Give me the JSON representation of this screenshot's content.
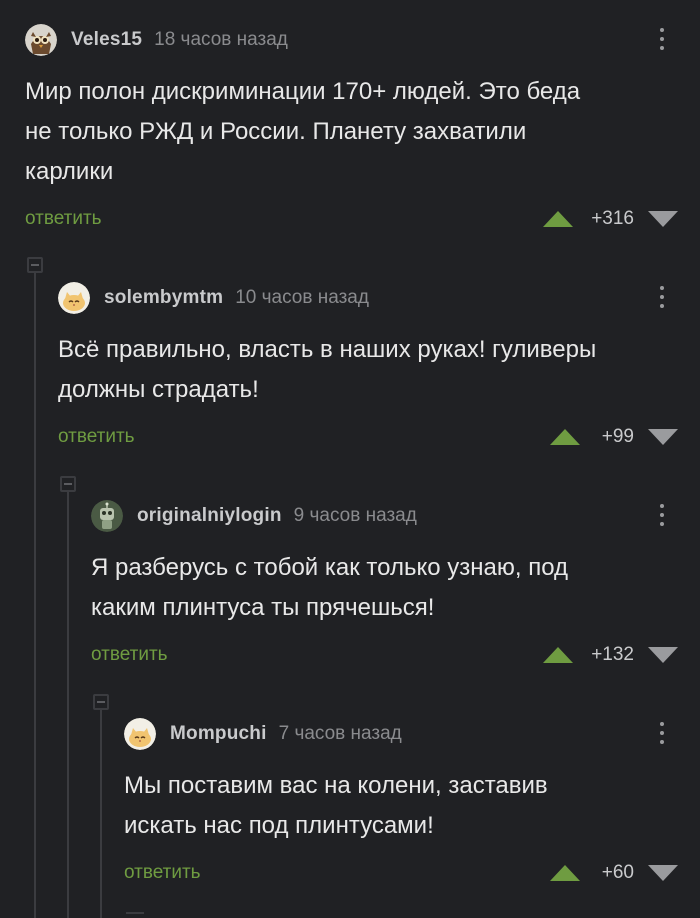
{
  "comments": [
    {
      "nick": "Veles15",
      "time": "18 часов назад",
      "text_lines": [
        "Мир полон дискриминации 170+ людей. Это беда",
        "не только РЖД и России. Планету захватили",
        "карлики"
      ],
      "reply_label": "ответить",
      "score": "+316",
      "avatar_icon": "owl-avatar-icon"
    },
    {
      "nick": "solembymtm",
      "time": "10 часов назад",
      "text_lines": [
        "Всё правильно, власть в наших руках! гуливеры",
        "должны страдать!"
      ],
      "reply_label": "ответить",
      "score": "+99",
      "avatar_icon": "cat-avatar-icon"
    },
    {
      "nick": "originalniylogin",
      "time": "9 часов назад",
      "text_lines": [
        "Я разберусь с тобой как только узнаю, под",
        "каким плинтуса ты прячешься!"
      ],
      "reply_label": "ответить",
      "score": "+132",
      "avatar_icon": "robot-avatar-icon"
    },
    {
      "nick": "Mompuchi",
      "time": "7 часов назад",
      "text_lines": [
        "Мы поставим вас на колени, заставив",
        "искать нас под плинтусами!"
      ],
      "reply_label": "ответить",
      "score": "+60",
      "avatar_icon": "cat-avatar-icon"
    }
  ],
  "colors": {
    "background": "#202124",
    "reply_link": "#6f9c41",
    "upvote": "#6f9c41",
    "downvote": "#9a9b9e",
    "thread_line": "#3b3c40"
  }
}
